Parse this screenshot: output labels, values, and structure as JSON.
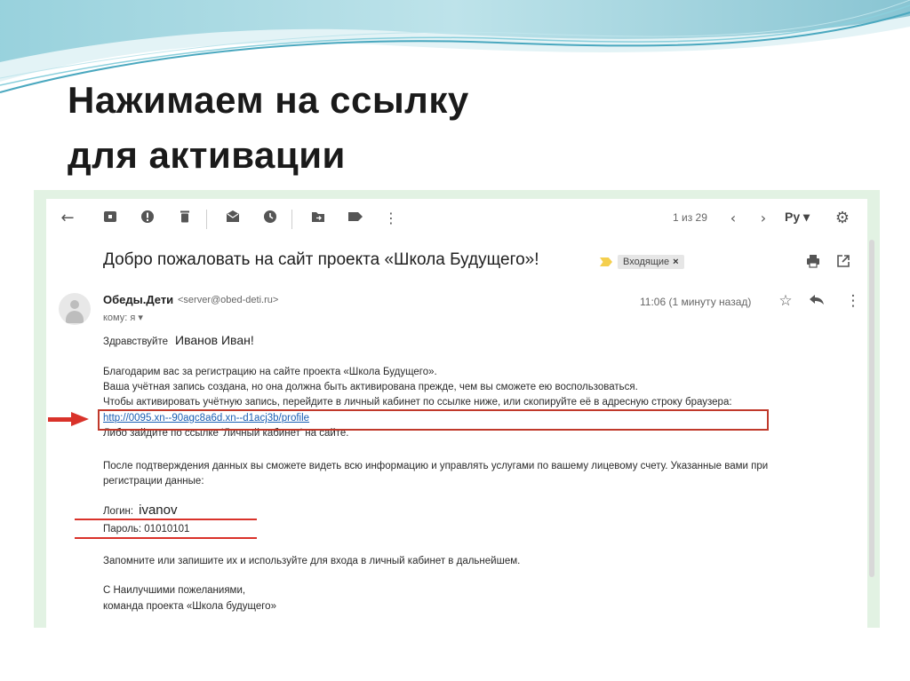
{
  "slide": {
    "title_line1": "Нажимаем на ссылку",
    "title_line2": "для активации"
  },
  "toolbar": {
    "icons": [
      "back-arrow-icon",
      "archive-icon",
      "report-spam-icon",
      "delete-icon",
      "mark-unread-icon",
      "snooze-icon",
      "move-to-icon",
      "label-icon",
      "more-vert-icon"
    ],
    "pager": "1 из 29",
    "lang": "Ру ▾"
  },
  "email": {
    "subject": "Добро пожаловать на сайт проекта «Школа Будущего»!",
    "label": "Входящие",
    "label_close": "×",
    "sender_name": "Обеды.Дети",
    "sender_email": "<server@obed-deti.ru>",
    "to_line": "кому: я ▾",
    "time": "11:06 (1 минуту назад)",
    "greeting": "Здравствуйте",
    "greeting_name": "Иванов Иван!",
    "para1_line1": "Благодарим вас за регистрацию на сайте проекта «Школа Будущего».",
    "para1_line2": "Ваша учётная запись создана, но она должна быть активирована прежде, чем вы сможете ею воспользоваться.",
    "para1_line3": "Чтобы активировать учётную запись, перейдите в личный кабинет по ссылке ниже, или скопируйте её в адресную строку браузера:",
    "activation_link": "http://0095.xn--90agc8a6d.xn--d1acj3b/profile",
    "para1_line5": "Либо зайдите по ссылке 'Личный кабинет' на сайте.",
    "para2_line1": "После подтверждения данных вы сможете видеть всю информацию и управлять услугами по вашему лицевому счету. Указанные вами при",
    "para2_line2": "регистрации данные:",
    "login_label": "Логин:",
    "login_value": "ivanov",
    "password_line": "Пароль: 01010101",
    "para3": "Запомните или запишите их и используйте для входа в личный кабинет в дальнейшем.",
    "sign1": "С Наилучшими пожеланиями,",
    "sign2": "команда проекта «Школа будущего»"
  },
  "colors": {
    "accent_red": "#d9322a",
    "link_blue": "#1a5fb4",
    "frame_green": "#e2f2e3"
  }
}
